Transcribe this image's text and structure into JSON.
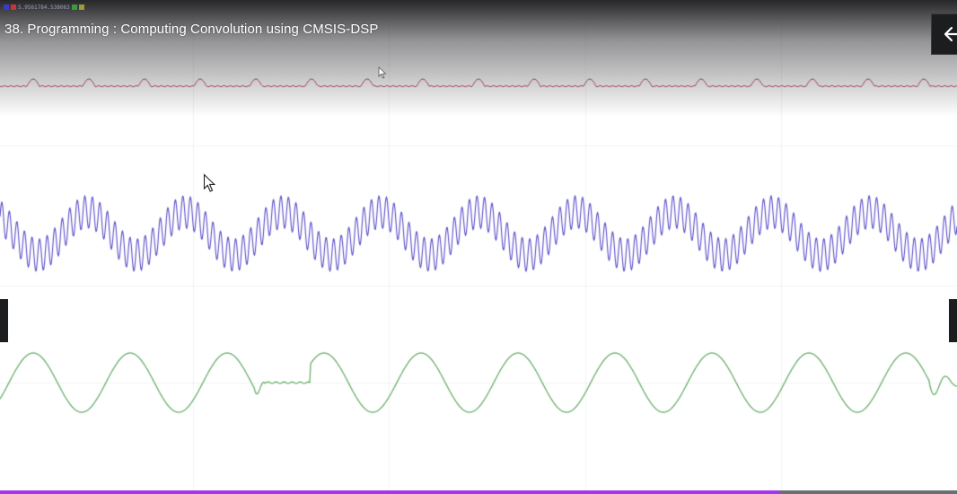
{
  "header": {
    "title": "38. Programming : Computing Convolution using CMSIS-DSP",
    "legend_text": "5.9561784.538063",
    "legend_colors": [
      "#3a3dc2",
      "#c8343a",
      "#3c9a3c",
      "#9a9a3c"
    ]
  },
  "controls": {
    "back_icon": "arrow-left-icon",
    "progress_fraction": 0.815,
    "progress_color": "#a435f0",
    "track_color": "#6a6f73"
  },
  "chart_data": {
    "type": "line",
    "title": "",
    "xlabel": "",
    "ylabel": "",
    "grid": true,
    "series": [
      {
        "color": "#c0475a",
        "description": "small periodic pulses",
        "period_samples": 62,
        "amplitude": 0.18
      },
      {
        "color": "#5a4fc8",
        "description": "low-frequency sine plus high-frequency ripple",
        "period_samples": 109,
        "ripple_period_samples": 8.4,
        "amplitude": 1.0
      },
      {
        "color": "#6db06d",
        "description": "filtered (convolved) sine, with glitches",
        "period_samples": 108,
        "amplitude": 1.0
      }
    ]
  }
}
